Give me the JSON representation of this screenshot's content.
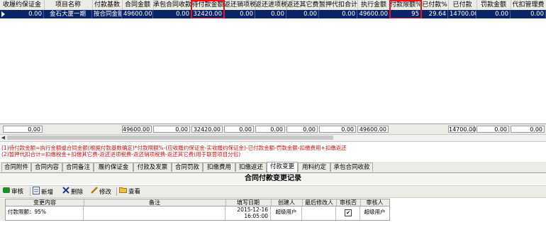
{
  "grid": {
    "headers": [
      "收履约保证金",
      "项目名称",
      "付款基数",
      "合同金额",
      "承包合同收款",
      "待付款金额",
      "返还销项税",
      "返还进项税",
      "返还其它费",
      "暂押代扣合计",
      "执行金额",
      "付款限额%",
      "已付款%",
      "已付款",
      "罚款金额",
      "代扣管理费"
    ],
    "row": [
      "0.00",
      "金石大厦一期",
      "按合同金额",
      "49600.00",
      "0.00",
      "32420.00",
      "0.00",
      "0.00",
      "0.00",
      "0.00",
      "49600.00",
      "95",
      "29.64",
      "14700.00",
      "0.00",
      "0.00"
    ],
    "summary": [
      "0.00",
      "",
      "",
      "49600.00",
      "0.00",
      "32420.00",
      "0.00",
      "0.00",
      "0.00",
      "0.00",
      "49600.00",
      "",
      "",
      "14700.00",
      "0.00",
      "0.00"
    ]
  },
  "notes": [
    "(1)待付款金额=执行金额或合同金额(根据付款基数确定)*付款限额%-(应收履约保证金-实收履约保证金)-已付款金额-罚款金额-扣缴费用+扣缴返还",
    "(2)暂押代扣合计=扣缴税金+扣缴其它费-返还进项税费-返还销项税费-返还其它费(用于联营项目分包)"
  ],
  "tabs": [
    "合同附件",
    "合同内容",
    "合同备注",
    "履约保证金",
    "付款及发票",
    "合同罚款",
    "扣缴费用",
    "扣缴返还",
    "付款变更",
    "用料约定",
    "承包合同收款"
  ],
  "active_tab": "付款变更",
  "panel_title": "合同付款变更记录",
  "toolbar": {
    "audit": "审核",
    "new": "新增",
    "delete": "删除",
    "edit": "修改",
    "view": "查看"
  },
  "sub_grid": {
    "headers": [
      "变更内容",
      "备注",
      "填写日期",
      "创建人",
      "最后修改人",
      "审核否",
      "审核人"
    ],
    "row": {
      "content": "付款限额：95%",
      "remark": "",
      "date_line1": "2015-12-16",
      "date_line2": "16:05:00",
      "creator": "超级用户",
      "modifier": "",
      "audited": "✔",
      "auditor": "超级用户"
    }
  },
  "colors": {
    "selected_row": "#0a246a",
    "highlight": "#e8141e",
    "note_text": "#d01010"
  }
}
